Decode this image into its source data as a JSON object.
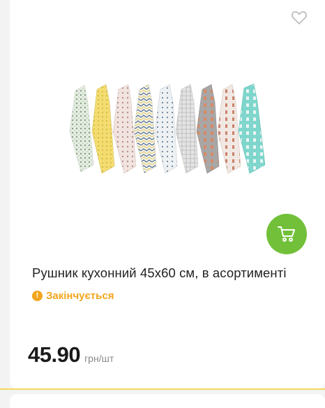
{
  "product": {
    "title": "Рушник кухонний 45х60 см, в асортименті",
    "stock_status": "Закінчується",
    "price": "45.90",
    "unit": "грн/шт",
    "image_alt": "kitchen towels assortment"
  },
  "icons": {
    "favorite": "heart-outline-icon",
    "cart": "shopping-cart-icon",
    "stock": "exclamation-circle-icon"
  },
  "colors": {
    "accent_green": "#72c03a",
    "warning_orange": "#f2a51c",
    "divider_yellow": "#f5d85a"
  }
}
